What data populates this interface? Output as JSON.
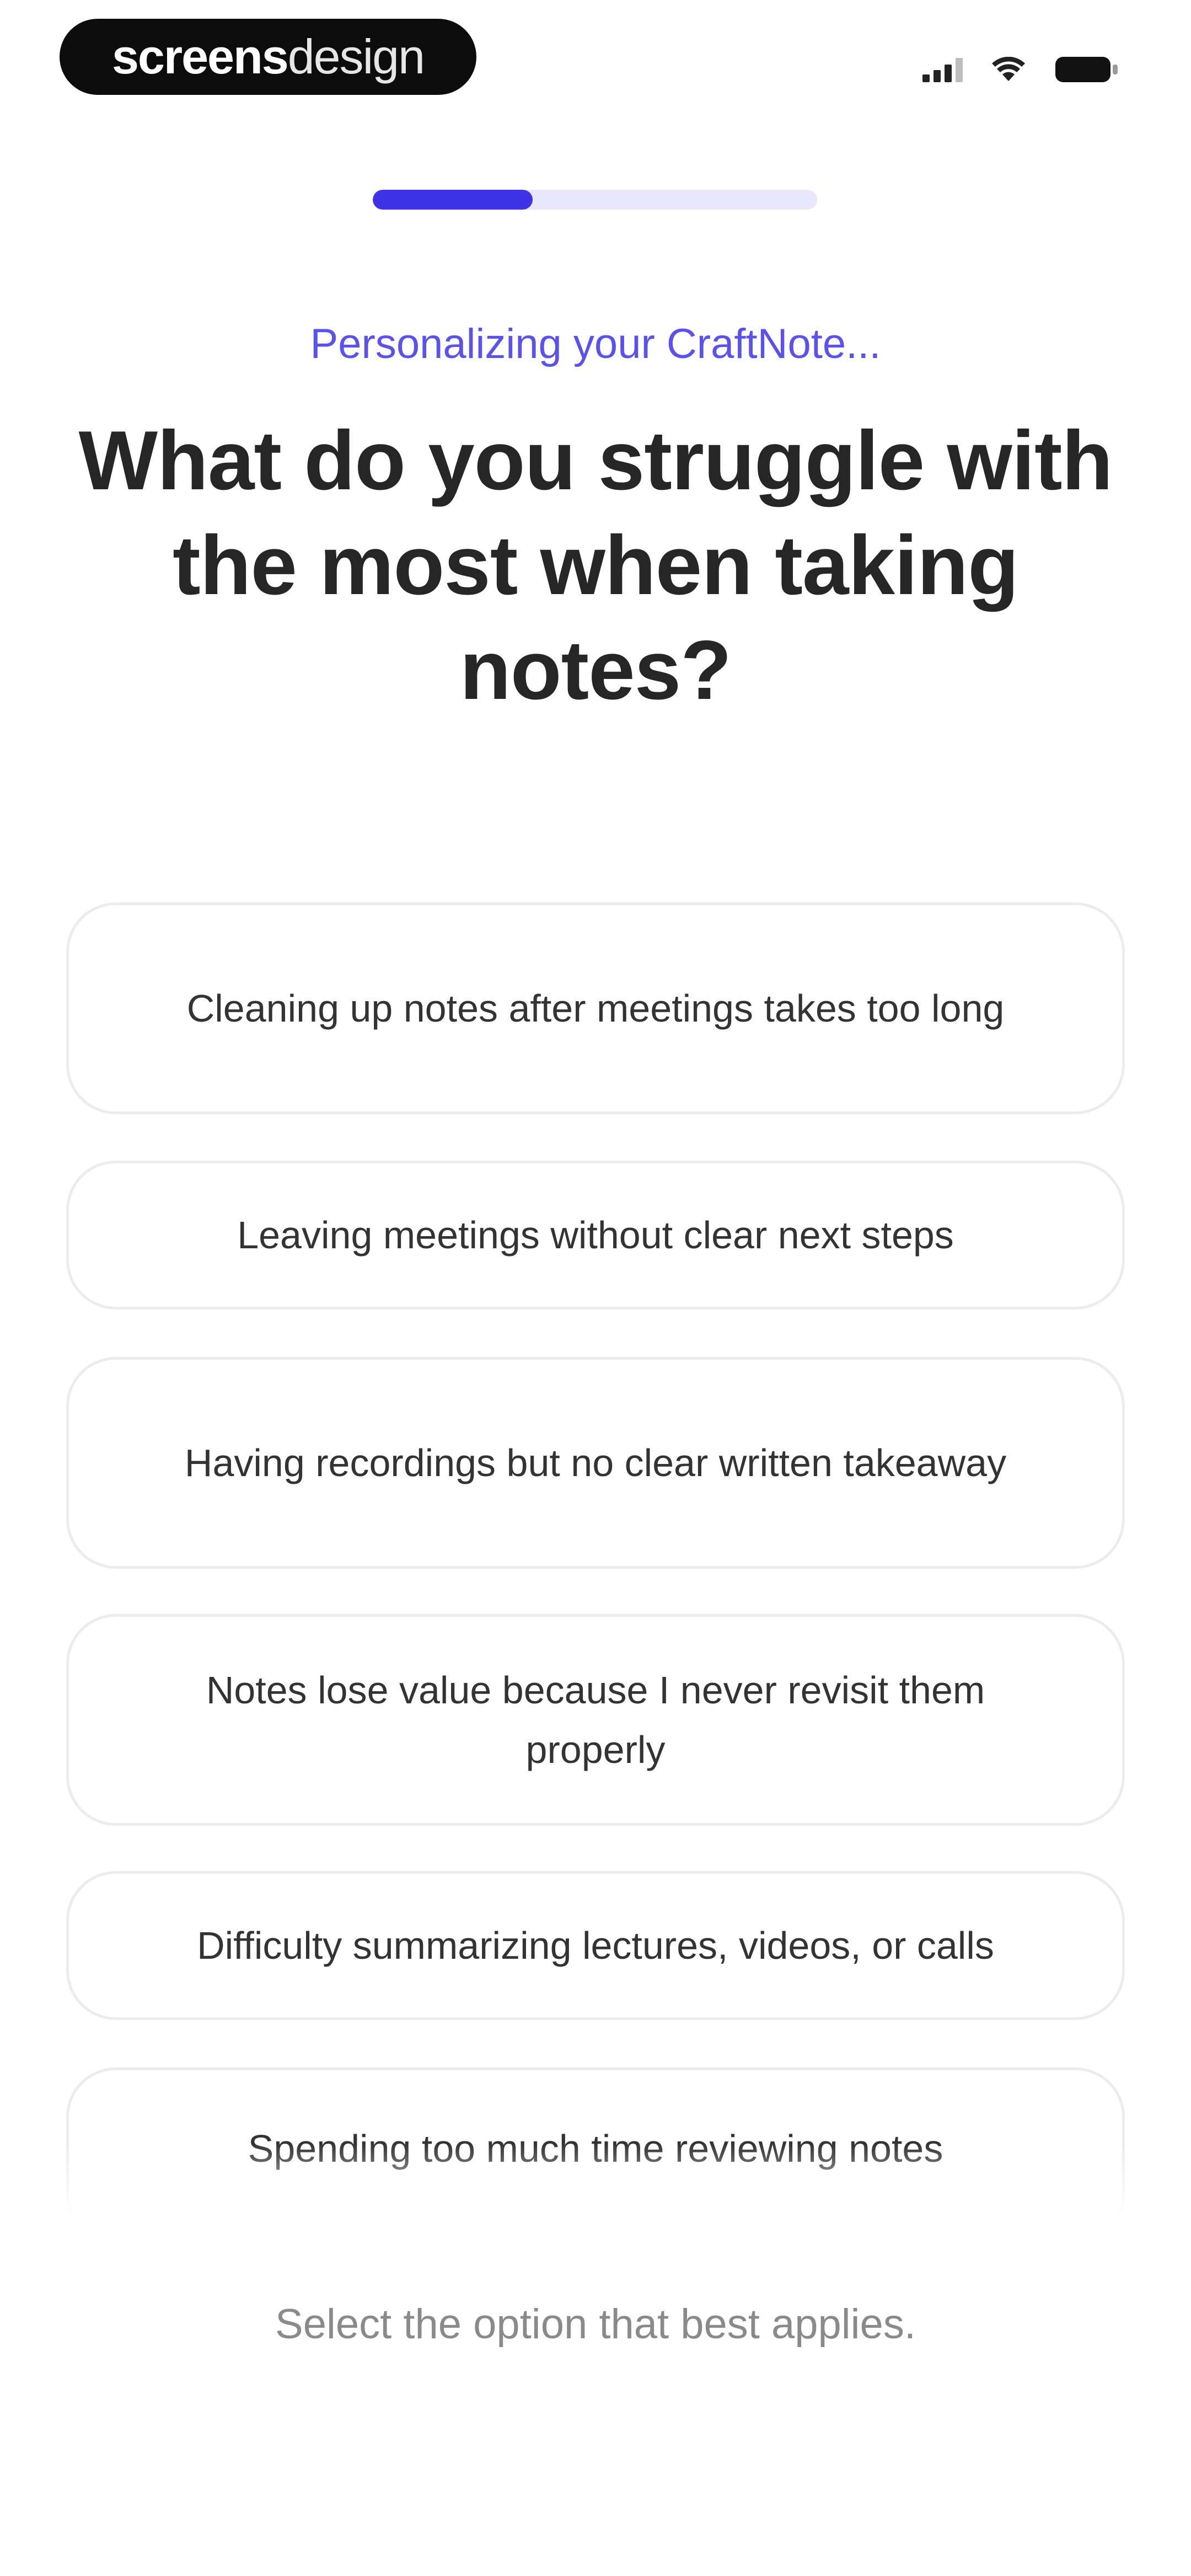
{
  "status_bar": {
    "brand_strong": "screens",
    "brand_light": "design",
    "icons": [
      "signal-icon",
      "wifi-icon",
      "battery-icon"
    ]
  },
  "progress": {
    "value_percent": 36
  },
  "eyebrow": "Personalizing your CraftNote...",
  "question": "What do you struggle with the most when taking notes?",
  "options": [
    "Cleaning up notes after meetings takes too long",
    "Leaving meetings without clear next steps",
    "Having recordings but no clear written takeaway",
    "Notes lose value because I never revisit them properly",
    "Difficulty summarizing lectures, videos, or calls",
    "Spending too much time reviewing notes"
  ],
  "hint": "Select the option that best applies.",
  "colors": {
    "accent": "#3f33e8",
    "accent_light": "#e8e6fb",
    "eyebrow": "#5b51ec"
  }
}
